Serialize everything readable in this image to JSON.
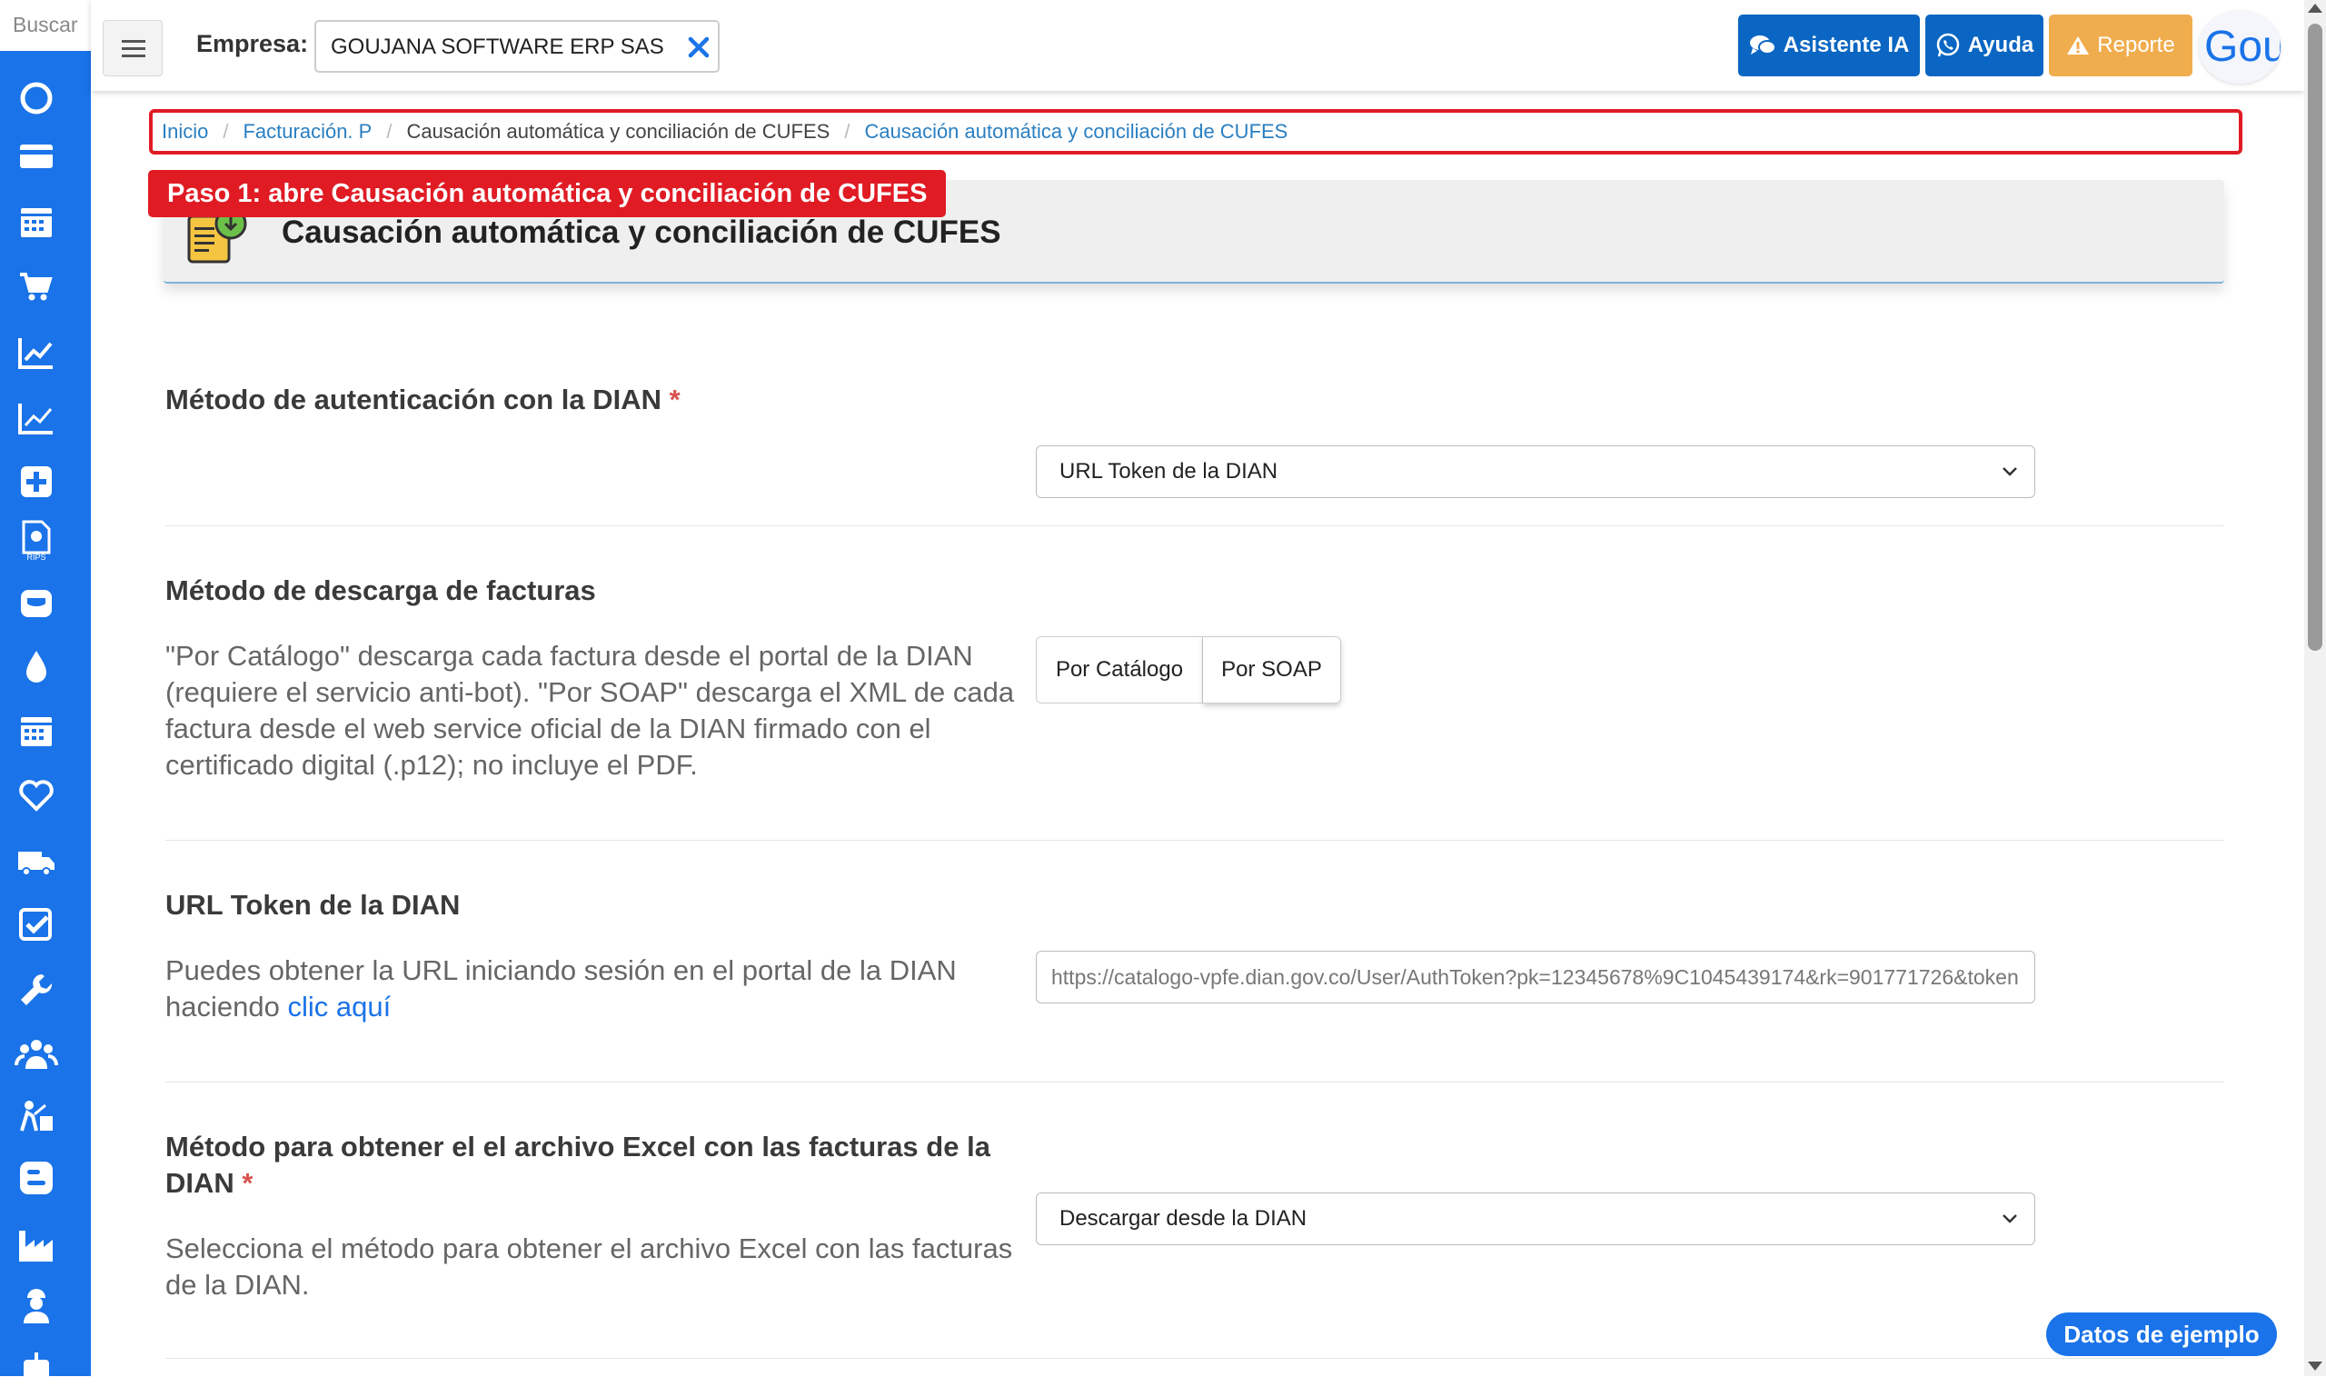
{
  "sidebar": {
    "search_label": "Buscar",
    "icons": [
      "circle-icon",
      "credit-card-icon",
      "calendar-icon",
      "cart-icon",
      "chart-line-icon",
      "chart-area-icon",
      "plus-square-icon",
      "rips-document-icon",
      "tooth-icon",
      "drop-icon",
      "calendar-alt-icon",
      "heart-icon",
      "truck-icon",
      "check-square-icon",
      "wrench-icon",
      "users-icon",
      "construction-icon",
      "blog-icon",
      "factory-icon",
      "worker-icon",
      "robot-icon"
    ]
  },
  "topbar": {
    "empresa_label": "Empresa:",
    "empresa_value": "GOUJANA SOFTWARE ERP SAS",
    "btn_ia": "Asistente IA",
    "btn_ayuda": "Ayuda",
    "btn_reporte": "Reporte",
    "brand_text": "Gou"
  },
  "breadcrumb": {
    "items": [
      "Inicio",
      "Facturación. P",
      "Causación automática y conciliación de CUFES",
      "Causación automática y conciliación de CUFES"
    ]
  },
  "step_tag": "Paso 1: abre Causación automática y conciliación de CUFES",
  "page_title": "Causación automática y conciliación de CUFES",
  "sections": {
    "auth": {
      "title": "Método de autenticación con la DIAN",
      "required": "*",
      "select_value": "URL Token de la DIAN"
    },
    "download": {
      "title": "Método de descarga de facturas",
      "desc": "\"Por Catálogo\" descarga cada factura desde el portal de la DIAN (requiere el servicio anti-bot). \"Por SOAP\" descarga el XML de cada factura desde el web service oficial de la DIAN firmado con el certificado digital (.p12); no incluye el PDF.",
      "option_catalogo": "Por Catálogo",
      "option_soap": "Por SOAP"
    },
    "token": {
      "title": "URL Token de la DIAN",
      "desc_prefix": "Puedes obtener la URL iniciando sesión en el portal de la DIAN haciendo ",
      "link_text": "clic aquí",
      "input_value": "https://catalogo-vpfe.dian.gov.co/User/AuthToken?pk=12345678%9C1045439174&rk=901771726&token"
    },
    "excel": {
      "title": "Método para obtener el el archivo Excel con las facturas de la DIAN",
      "required": "*",
      "desc": "Selecciona el método para obtener el archivo Excel con las facturas de la DIAN.",
      "select_value": "Descargar desde la DIAN"
    }
  },
  "datos_ejemplo": "Datos de ejemplo",
  "colors": {
    "primary": "#1a73e8",
    "danger": "#e01b24",
    "warning": "#f0ad4e"
  }
}
